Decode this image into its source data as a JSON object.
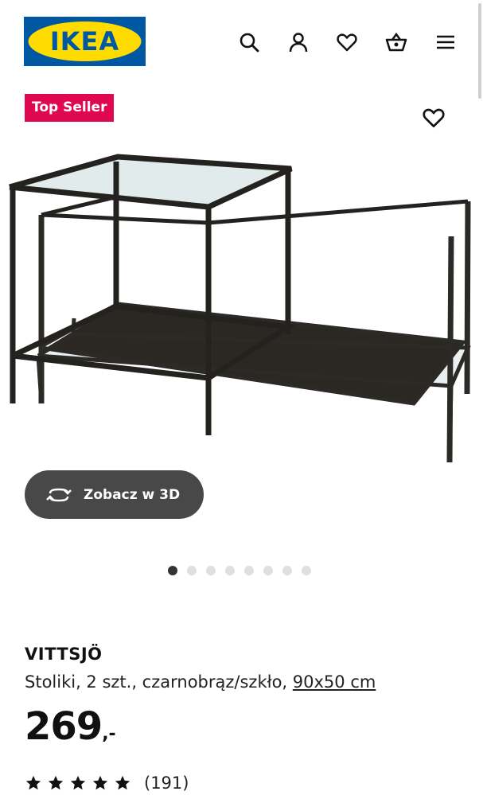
{
  "header": {
    "logo_text": "IKEA",
    "icons": [
      "search-icon",
      "user-icon",
      "heart-icon",
      "basket-icon",
      "hamburger-menu-icon"
    ]
  },
  "colors": {
    "logo_blue": "#0058a3",
    "logo_yellow": "#ffdb00",
    "badge_red": "#e00751",
    "button_dark": "#484848"
  },
  "badge": {
    "label": "Top Seller"
  },
  "view3d": {
    "label": "Zobacz w 3D",
    "icon": "rotate-3d-icon"
  },
  "carousel": {
    "total": 8,
    "active_index": 0
  },
  "product": {
    "name": "VITTSJÖ",
    "description": "Stoliki, 2 szt., czarnobrąz/szkło, ",
    "size": "90x50 cm",
    "price": "269",
    "price_suffix": ",-",
    "rating_stars": 5,
    "reviews": "(191)"
  }
}
